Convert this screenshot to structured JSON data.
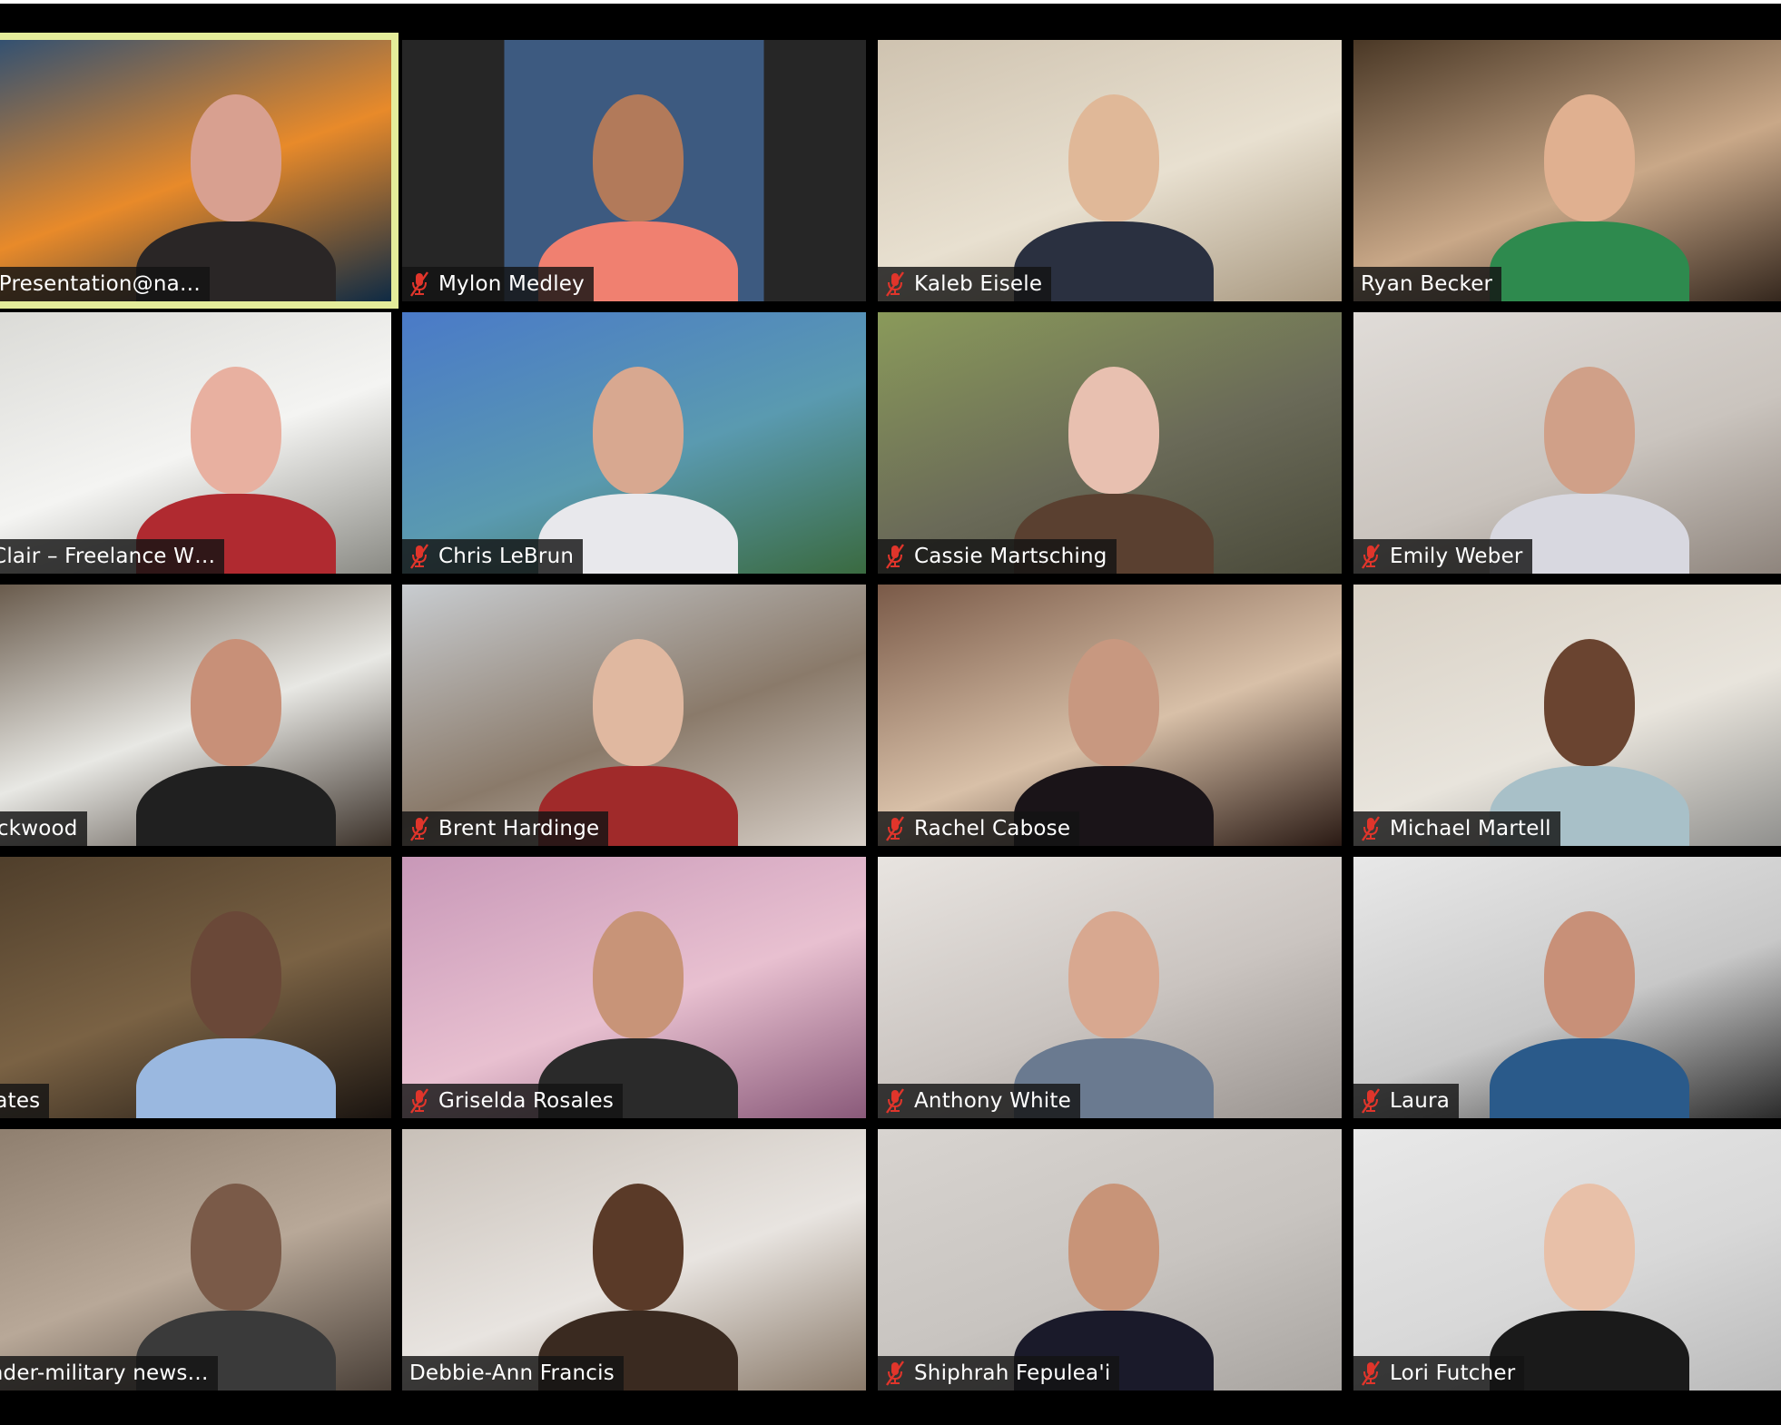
{
  "app": "Zoom - Gallery View",
  "colors": {
    "active_speaker_border": "#e4ec9a",
    "muted_icon": "#e0352b",
    "label_bg": "#141414",
    "label_text": "#ffffff",
    "background": "#000000"
  },
  "participants": [
    {
      "name": "eynotePresentation@na…",
      "muted": false,
      "active_speaker": true,
      "bg": [
        "#1d4a7a",
        "#e88a2a",
        "#0e2a44"
      ],
      "skin": "#d8a090",
      "shirt": "#2a2626"
    },
    {
      "name": "Mylon Medley",
      "muted": true,
      "active_speaker": false,
      "bg": [
        "#262626",
        "#3d5a80",
        "#262626"
      ],
      "skin": "#b27a5a",
      "shirt": "#f08070"
    },
    {
      "name": "Kaleb Eisele",
      "muted": true,
      "active_speaker": false,
      "bg": [
        "#cfc3b0",
        "#e8e0d0",
        "#a89880"
      ],
      "skin": "#e0b898",
      "shirt": "#2a3040"
    },
    {
      "name": "Ryan Becker",
      "muted": false,
      "active_speaker": false,
      "bg": [
        "#4a3826",
        "#c9a888",
        "#2a1e16"
      ],
      "skin": "#e0b090",
      "shirt": "#2e8a4e"
    },
    {
      "name": "ky St. Clair – Freelance W…",
      "muted": false,
      "active_speaker": false,
      "bg": [
        "#d8d8d4",
        "#f4f4f2",
        "#8a8a84"
      ],
      "skin": "#e8b0a0",
      "shirt": "#b02a30"
    },
    {
      "name": "Chris LeBrun",
      "muted": true,
      "active_speaker": false,
      "bg": [
        "#4a7ac8",
        "#5a9ab0",
        "#3a6a40"
      ],
      "skin": "#d8a890",
      "shirt": "#e8e8ec"
    },
    {
      "name": "Cassie Martsching",
      "muted": true,
      "active_speaker": false,
      "bg": [
        "#8a9a5a",
        "#6a6a58",
        "#4a4a3a"
      ],
      "skin": "#e8c0b0",
      "shirt": "#5a4030"
    },
    {
      "name": "Emily Weber",
      "muted": true,
      "active_speaker": false,
      "bg": [
        "#e0dcd8",
        "#cac4be",
        "#8a8078"
      ],
      "skin": "#d0a088",
      "shirt": "#d8d8e0"
    },
    {
      "name": "iree.Lockwood",
      "muted": false,
      "active_speaker": false,
      "bg": [
        "#5a4a3a",
        "#e8e8e4",
        "#3a3028"
      ],
      "skin": "#c89078",
      "shirt": "#202020"
    },
    {
      "name": "Brent Hardinge",
      "muted": true,
      "active_speaker": false,
      "bg": [
        "#c8ccd0",
        "#8a7a6a",
        "#d8d0c8"
      ],
      "skin": "#e0b8a0",
      "shirt": "#a02a2a"
    },
    {
      "name": "Rachel Cabose",
      "muted": true,
      "active_speaker": false,
      "bg": [
        "#7a5a48",
        "#d8c0a8",
        "#2a1a14"
      ],
      "skin": "#c89880",
      "shirt": "#1a1418"
    },
    {
      "name": "Michael Martell",
      "muted": true,
      "active_speaker": false,
      "bg": [
        "#d8d0c4",
        "#e8e4dc",
        "#8a8a88"
      ],
      "skin": "#6a4430",
      "shirt": "#a8c0c8"
    },
    {
      "name": "nnye Yates",
      "muted": false,
      "active_speaker": false,
      "bg": [
        "#4a3a28",
        "#7a6244",
        "#1a1410"
      ],
      "skin": "#6a4838",
      "shirt": "#9ab8e0"
    },
    {
      "name": "Griselda Rosales",
      "muted": true,
      "active_speaker": false,
      "bg": [
        "#c898b8",
        "#e8c0d0",
        "#8a5a7a"
      ],
      "skin": "#c89478",
      "shirt": "#2a2a2a"
    },
    {
      "name": "Anthony White",
      "muted": true,
      "active_speaker": false,
      "bg": [
        "#e8e4e0",
        "#cac4c0",
        "#9a9490"
      ],
      "skin": "#d8a890",
      "shirt": "#6a7a90"
    },
    {
      "name": "Laura",
      "muted": true,
      "active_speaker": false,
      "bg": [
        "#e8e8e8",
        "#c8c8c8",
        "#202020"
      ],
      "skin": "#c89078",
      "shirt": "#2a5a8a"
    },
    {
      "name": "hel Ponder-military news…",
      "muted": false,
      "active_speaker": false,
      "bg": [
        "#8a7a6a",
        "#b8a898",
        "#4a4038"
      ],
      "skin": "#7a5a48",
      "shirt": "#3a3a3a"
    },
    {
      "name": "Debbie-Ann Francis",
      "muted": false,
      "active_speaker": false,
      "bg": [
        "#c8c0b8",
        "#e8e4e0",
        "#8a7a6a"
      ],
      "skin": "#5a3a28",
      "shirt": "#3a2a20"
    },
    {
      "name": "Shiphrah Fepulea'i",
      "muted": true,
      "active_speaker": false,
      "bg": [
        "#d8d4d0",
        "#c8c4c0",
        "#a8a4a0"
      ],
      "skin": "#c89478",
      "shirt": "#1a1a2a"
    },
    {
      "name": "Lori Futcher",
      "muted": true,
      "active_speaker": false,
      "bg": [
        "#e8e8e8",
        "#d8d8d8",
        "#b8b8b8"
      ],
      "skin": "#e8c0a8",
      "shirt": "#1a1a1a"
    }
  ]
}
